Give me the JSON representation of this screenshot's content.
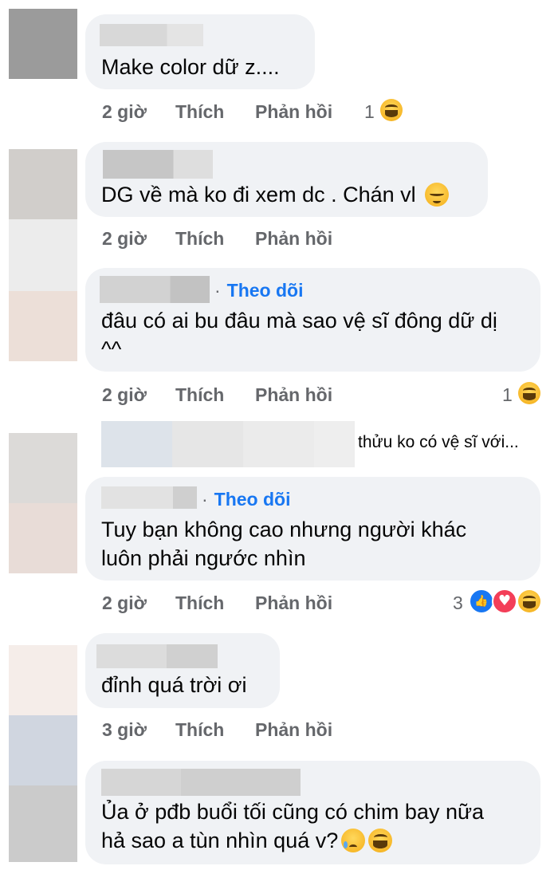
{
  "comments": [
    {
      "text": "Make color dữ z....",
      "time": "2 giờ",
      "like": "Thích",
      "reply": "Phản hồi",
      "reaction_count": "1"
    },
    {
      "text": "DG về mà ko đi xem dc . Chán vl",
      "time": "2 giờ",
      "like": "Thích",
      "reply": "Phản hồi"
    },
    {
      "text_line1": "đâu có ai bu đâu mà sao vệ sĩ đông dữ dị",
      "text_line2": "^^",
      "follow": "Theo dõi",
      "time": "2 giờ",
      "like": "Thích",
      "reply": "Phản hồi",
      "reaction_count": "1"
    },
    {
      "reply_preview": "thửu ko có vệ sĩ với..."
    },
    {
      "text_line1": "Tuy bạn không cao nhưng người khác",
      "text_line2": "luôn phải ngước nhìn",
      "follow": "Theo dõi",
      "time": "2 giờ",
      "like": "Thích",
      "reply": "Phản hồi",
      "reaction_count": "3"
    },
    {
      "text": "đỉnh quá trời ơi",
      "time": "3 giờ",
      "like": "Thích",
      "reply": "Phản hồi"
    },
    {
      "text_line1": "Ủa ở pđb buổi tối cũng có chim bay nữa",
      "text_line2": "hả sao a tùn nhìn quá v?"
    }
  ],
  "follow_dot": "·",
  "colors": {
    "bubble": "#f0f2f5",
    "link_blue": "#1877f2",
    "meta_gray": "#65676b"
  },
  "icons": [
    "laughing-emoji-icon",
    "relieved-emoji-icon",
    "like-reaction-icon",
    "love-reaction-icon",
    "crying-emoji-icon"
  ]
}
